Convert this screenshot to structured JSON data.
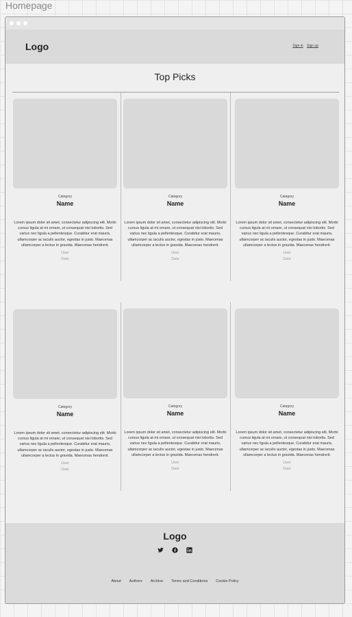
{
  "frame": {
    "title": "Homepage"
  },
  "header": {
    "logo": "Logo",
    "sign_in": "Sign in",
    "sign_up": "Sign up"
  },
  "section": {
    "title": "Top Picks"
  },
  "cards": [
    {
      "category": "Category",
      "name": "Name",
      "description": "Lorem ipsum dolor sit amet, consectetur adipiscing elit. Morbi cursus ligula at mi ornare, ut consequat nisi lobortis. Sed varius nec ligula a pellentesque. Curabitur erat mauris, ullamcorper ac iaculis auctor, egestas in justo. Maecenas ullamcorper a lectus in gravida. Maecenas hendrerit.",
      "user": "User",
      "date": "Date"
    },
    {
      "category": "Category",
      "name": "Name",
      "description": "Lorem ipsum dolor sit amet, consectetur adipiscing elit. Morbi cursus ligula at mi ornare, ut consequat nisi lobortis. Sed varius nec ligula a pellentesque. Curabitur erat mauris, ullamcorper ac iaculis auctor, egestas in justo. Maecenas ullamcorper a lectus in gravida. Maecenas hendrerit.",
      "user": "User",
      "date": "Date"
    },
    {
      "category": "Category",
      "name": "Name",
      "description": "Lorem ipsum dolor sit amet, consectetur adipiscing elit. Morbi cursus ligula at mi ornare, ut consequat nisi lobortis. Sed varius nec ligula a pellentesque. Curabitur erat mauris, ullamcorper ac iaculis auctor, egestas in justo. Maecenas ullamcorper a lectus in gravida. Maecenas hendrerit.",
      "user": "User",
      "date": "Date"
    },
    {
      "category": "Category",
      "name": "Name",
      "description": "Lorem ipsum dolor sit amet, consectetur adipiscing elit. Morbi cursus ligula at mi ornare, ut consequat nisi lobortis. Sed varius nec ligula a pellentesque. Curabitur erat mauris, ullamcorper ac iaculis auctor, egestas in justo. Maecenas ullamcorper a lectus in gravida. Maecenas hendrerit.",
      "user": "User",
      "date": "Date"
    },
    {
      "category": "Category",
      "name": "Name",
      "description": "Lorem ipsum dolor sit amet, consectetur adipiscing elit. Morbi cursus ligula at mi ornare, ut consequat nisi lobortis. Sed varius nec ligula a pellentesque. Curabitur erat mauris, ullamcorper ac iaculis auctor, egestas in justo. Maecenas ullamcorper a lectus in gravida. Maecenas hendrerit.",
      "user": "User",
      "date": "Date"
    },
    {
      "category": "Category",
      "name": "Name",
      "description": "Lorem ipsum dolor sit amet, consectetur adipiscing elit. Morbi cursus ligula at mi ornare, ut consequat nisi lobortis. Sed varius nec ligula a pellentesque. Curabitur erat mauris, ullamcorper ac iaculis auctor, egestas in justo. Maecenas ullamcorper a lectus in gravida. Maecenas hendrerit.",
      "user": "User",
      "date": "Date"
    }
  ],
  "footer": {
    "logo": "Logo",
    "social": [
      {
        "icon": "twitter-icon"
      },
      {
        "icon": "facebook-icon"
      },
      {
        "icon": "linkedin-icon"
      }
    ],
    "links": [
      "About",
      "Authors",
      "Archive",
      "Terms and Conditions",
      "Cookie Policy"
    ]
  }
}
